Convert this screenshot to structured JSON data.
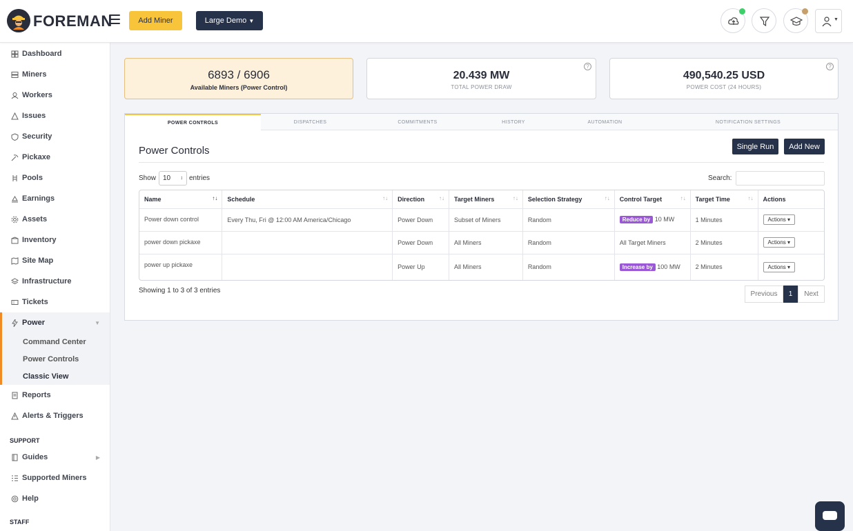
{
  "header": {
    "brand": "FOREMAN",
    "add_miner_label": "Add Miner",
    "demo_label": "Large Demo",
    "status_colors": {
      "upload": "#3ccf6a",
      "learn": "#c79f6a"
    }
  },
  "sidebar": {
    "items": [
      {
        "label": "Dashboard",
        "icon": "dashboard-icon"
      },
      {
        "label": "Miners",
        "icon": "server-icon"
      },
      {
        "label": "Workers",
        "icon": "workers-icon"
      },
      {
        "label": "Issues",
        "icon": "warning-icon"
      },
      {
        "label": "Security",
        "icon": "shield-icon"
      },
      {
        "label": "Pickaxe",
        "icon": "pickaxe-icon"
      },
      {
        "label": "Pools",
        "icon": "pools-icon"
      },
      {
        "label": "Earnings",
        "icon": "earnings-icon"
      },
      {
        "label": "Assets",
        "icon": "gear-icon"
      },
      {
        "label": "Inventory",
        "icon": "inventory-icon"
      },
      {
        "label": "Site Map",
        "icon": "map-icon"
      },
      {
        "label": "Infrastructure",
        "icon": "layers-icon"
      },
      {
        "label": "Tickets",
        "icon": "ticket-icon"
      }
    ],
    "power": {
      "label": "Power",
      "children": [
        "Command Center",
        "Power Controls",
        "Classic View"
      ]
    },
    "items_after": [
      {
        "label": "Reports",
        "icon": "report-icon"
      },
      {
        "label": "Alerts & Triggers",
        "icon": "alert-icon"
      }
    ],
    "support_label": "SUPPORT",
    "support_items": [
      {
        "label": "Guides",
        "icon": "book-icon"
      },
      {
        "label": "Supported Miners",
        "icon": "list-icon"
      },
      {
        "label": "Help",
        "icon": "help-icon"
      }
    ],
    "staff_label": "STAFF"
  },
  "stats": {
    "available": {
      "value": "6893 / 6906",
      "label": "Available Miners (Power Control)"
    },
    "power_draw": {
      "value": "20.439 MW",
      "label": "TOTAL POWER DRAW"
    },
    "power_cost": {
      "value": "490,540.25 USD",
      "label": "POWER COST (24 HOURS)"
    }
  },
  "tabs": [
    "POWER CONTROLS",
    "DISPATCHES",
    "COMMITMENTS",
    "HISTORY",
    "AUTOMATION",
    "NOTIFICATION SETTINGS"
  ],
  "panel": {
    "title": "Power Controls",
    "single_run_label": "Single Run",
    "add_new_label": "Add New",
    "show_label": "Show",
    "entries_value": "10",
    "entries_label": "entries",
    "search_label": "Search:"
  },
  "table": {
    "columns": [
      "Name",
      "Schedule",
      "Direction",
      "Target Miners",
      "Selection Strategy",
      "Control Target",
      "Target Time",
      "Actions"
    ],
    "rows": [
      {
        "name": "Power down control",
        "schedule": "Every Thu, Fri @ 12:00 AM America/Chicago",
        "direction": "Power Down",
        "target_miners": "Subset of Miners",
        "strategy": "Random",
        "badge": "Reduce by",
        "target_value": "10 MW",
        "target_time": "1 Minutes",
        "action": "Actions"
      },
      {
        "name": "power down pickaxe",
        "schedule": "",
        "direction": "Power Down",
        "target_miners": "All Miners",
        "strategy": "Random",
        "badge": "",
        "target_value": "All Target Miners",
        "target_time": "2 Minutes",
        "action": "Actions"
      },
      {
        "name": "power up pickaxe",
        "schedule": "",
        "direction": "Power Up",
        "target_miners": "All Miners",
        "strategy": "Random",
        "badge": "Increase by",
        "target_value": "100 MW",
        "target_time": "2 Minutes",
        "action": "Actions"
      }
    ],
    "info": "Showing 1 to 3 of 3 entries",
    "pagination": {
      "previous": "Previous",
      "current": "1",
      "next": "Next"
    }
  }
}
